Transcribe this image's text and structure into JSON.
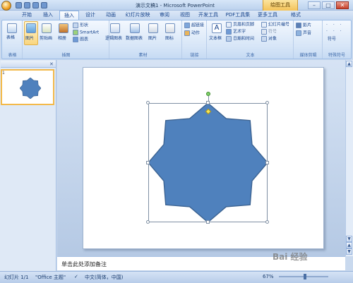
{
  "window": {
    "title": "演示文稿1 - Microsoft PowerPoint",
    "contextual_tab": "绘图工具",
    "minimize": "–",
    "maximize": "□",
    "close": "✕"
  },
  "tabs": [
    "开始",
    "插入",
    "设计",
    "动画",
    "幻灯片放映",
    "审阅",
    "视图",
    "开发工具",
    "PDF工具集",
    "更多工具",
    "格式"
  ],
  "active_tab": "插入",
  "ribbon": {
    "groups": {
      "tables": {
        "label": "表格",
        "buttons": [
          "表格"
        ]
      },
      "illustrations": {
        "label": "插图",
        "buttons": [
          "图片",
          "剪贴画",
          "相册",
          "形状",
          "SmartArt",
          "图表"
        ]
      },
      "materials": {
        "label": "素材",
        "buttons": [
          "逻辑图表",
          "数据图表",
          "图片",
          "图标"
        ]
      },
      "links": {
        "label": "链接",
        "buttons": [
          "超链接",
          "动作"
        ]
      },
      "text": {
        "label": "文本",
        "buttons": [
          "文本框",
          "页眉和页脚",
          "艺术字",
          "日期和时间",
          "幻灯片编号",
          "符号",
          "对象"
        ]
      },
      "media": {
        "label": "媒体剪辑",
        "buttons": [
          "影片",
          "声音"
        ]
      },
      "special": {
        "label": "特殊符号",
        "buttons": [
          "符号"
        ]
      }
    }
  },
  "slides_panel": {
    "slide_number": "1"
  },
  "notes_placeholder": "单击此处添加备注",
  "status": {
    "slide_info": "幻灯片 1/1",
    "theme": "\"Office 主题\"",
    "language": "中文(简体，中国)",
    "zoom": "67%"
  },
  "watermark": "Bai 经验",
  "colors": {
    "shape_fill": "#4f81bd",
    "shape_border": "#3a6190",
    "ribbon_bg": "#d6e5f7",
    "contextual_tab": "#f4c35a"
  }
}
